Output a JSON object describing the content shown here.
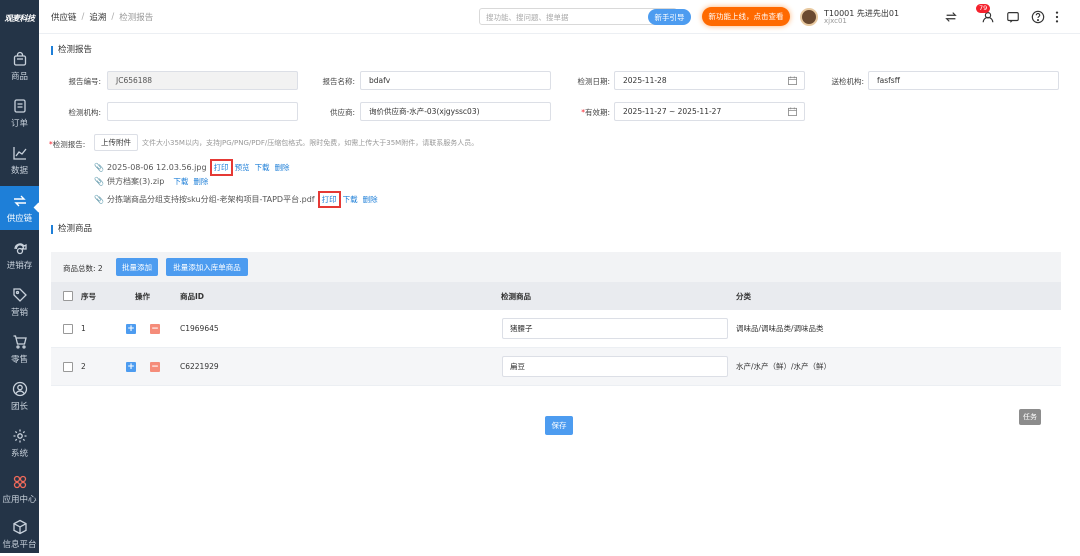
{
  "sidebar": {
    "logo": "观麦科技",
    "items": [
      {
        "label": "商品",
        "icon": "bag-icon"
      },
      {
        "label": "订单",
        "icon": "order-icon"
      },
      {
        "label": "数据",
        "icon": "chart-icon"
      },
      {
        "label": "供应链",
        "icon": "supply-chain-icon",
        "active": true
      },
      {
        "label": "进销存",
        "icon": "inventory-icon"
      },
      {
        "label": "营销",
        "icon": "tag-icon"
      },
      {
        "label": "零售",
        "icon": "cart-icon"
      },
      {
        "label": "团长",
        "icon": "user-icon"
      },
      {
        "label": "系统",
        "icon": "gear-icon"
      },
      {
        "label": "应用中心",
        "icon": "apps-icon"
      },
      {
        "label": "信息平台",
        "icon": "cube-icon"
      }
    ]
  },
  "topbar": {
    "breadcrumb": [
      "供应链",
      "追溯",
      "检测报告"
    ],
    "search_placeholder": "搜功能、搜问题、搜单据",
    "guide_label": "新手引导",
    "promo_label": "新功能上线，点击查看",
    "user_name": "T10001 先进先出01",
    "user_sub": "xjxc01",
    "notification_count": "79"
  },
  "report": {
    "section_title": "检测报告",
    "fields": {
      "report_no_label": "报告编号:",
      "report_no_value": "JC656188",
      "report_name_label": "报告名称:",
      "report_name_value": "bdafv",
      "test_date_label": "检测日期:",
      "test_date_value": "2025-11-28",
      "submit_org_label": "送检机构:",
      "submit_org_value": "fasfsff",
      "test_org_label": "检测机构:",
      "test_org_value": "",
      "supplier_label": "供应商:",
      "supplier_value": "询价供应商-水产-03(xjgyssc03)",
      "validity_req": "*",
      "validity_label": "有效期:",
      "validity_value": "2025-11-27 ~ 2025-11-27"
    },
    "attach_req": "*",
    "attach_label": "检测报告:",
    "upload_label": "上传附件",
    "upload_hint": "文件大小35M以内，支持JPG/PNG/PDF/压缩包格式。限时免费，如需上传大于35M附件，请联系服务人员。",
    "files": [
      {
        "name": "2025-08-06 12.03.56.jpg",
        "actions": [
          "打印",
          "预览",
          "下载",
          "删除"
        ]
      },
      {
        "name": "供方档案(3).zip",
        "actions": [
          "下载",
          "删除"
        ]
      },
      {
        "name": "分拣端商品分组支持按sku分组-老架构项目-TAPD平台.pdf",
        "actions": [
          "打印",
          "下载",
          "删除"
        ]
      }
    ]
  },
  "goods": {
    "section_title": "检测商品",
    "count_label": "商品总数: 2",
    "batch_add_label": "批量添加",
    "batch_add_stock_label": "批量添加入库单商品",
    "columns": [
      "序号",
      "操作",
      "商品ID",
      "检测商品",
      "分类"
    ],
    "rows": [
      {
        "no": "1",
        "id": "C1969645",
        "name": "猪腰子",
        "category": "调味品/调味品类/调味品类"
      },
      {
        "no": "2",
        "id": "C6221929",
        "name": "扁豆",
        "category": "水产/水产（鲜）/水产（鲜）"
      }
    ],
    "save_label": "保存"
  },
  "task_label": "任务",
  "colors": {
    "primary": "#1e7fd8",
    "sidebar": "#243447",
    "promo": "#ff6a00",
    "highlight": "#e53935"
  }
}
